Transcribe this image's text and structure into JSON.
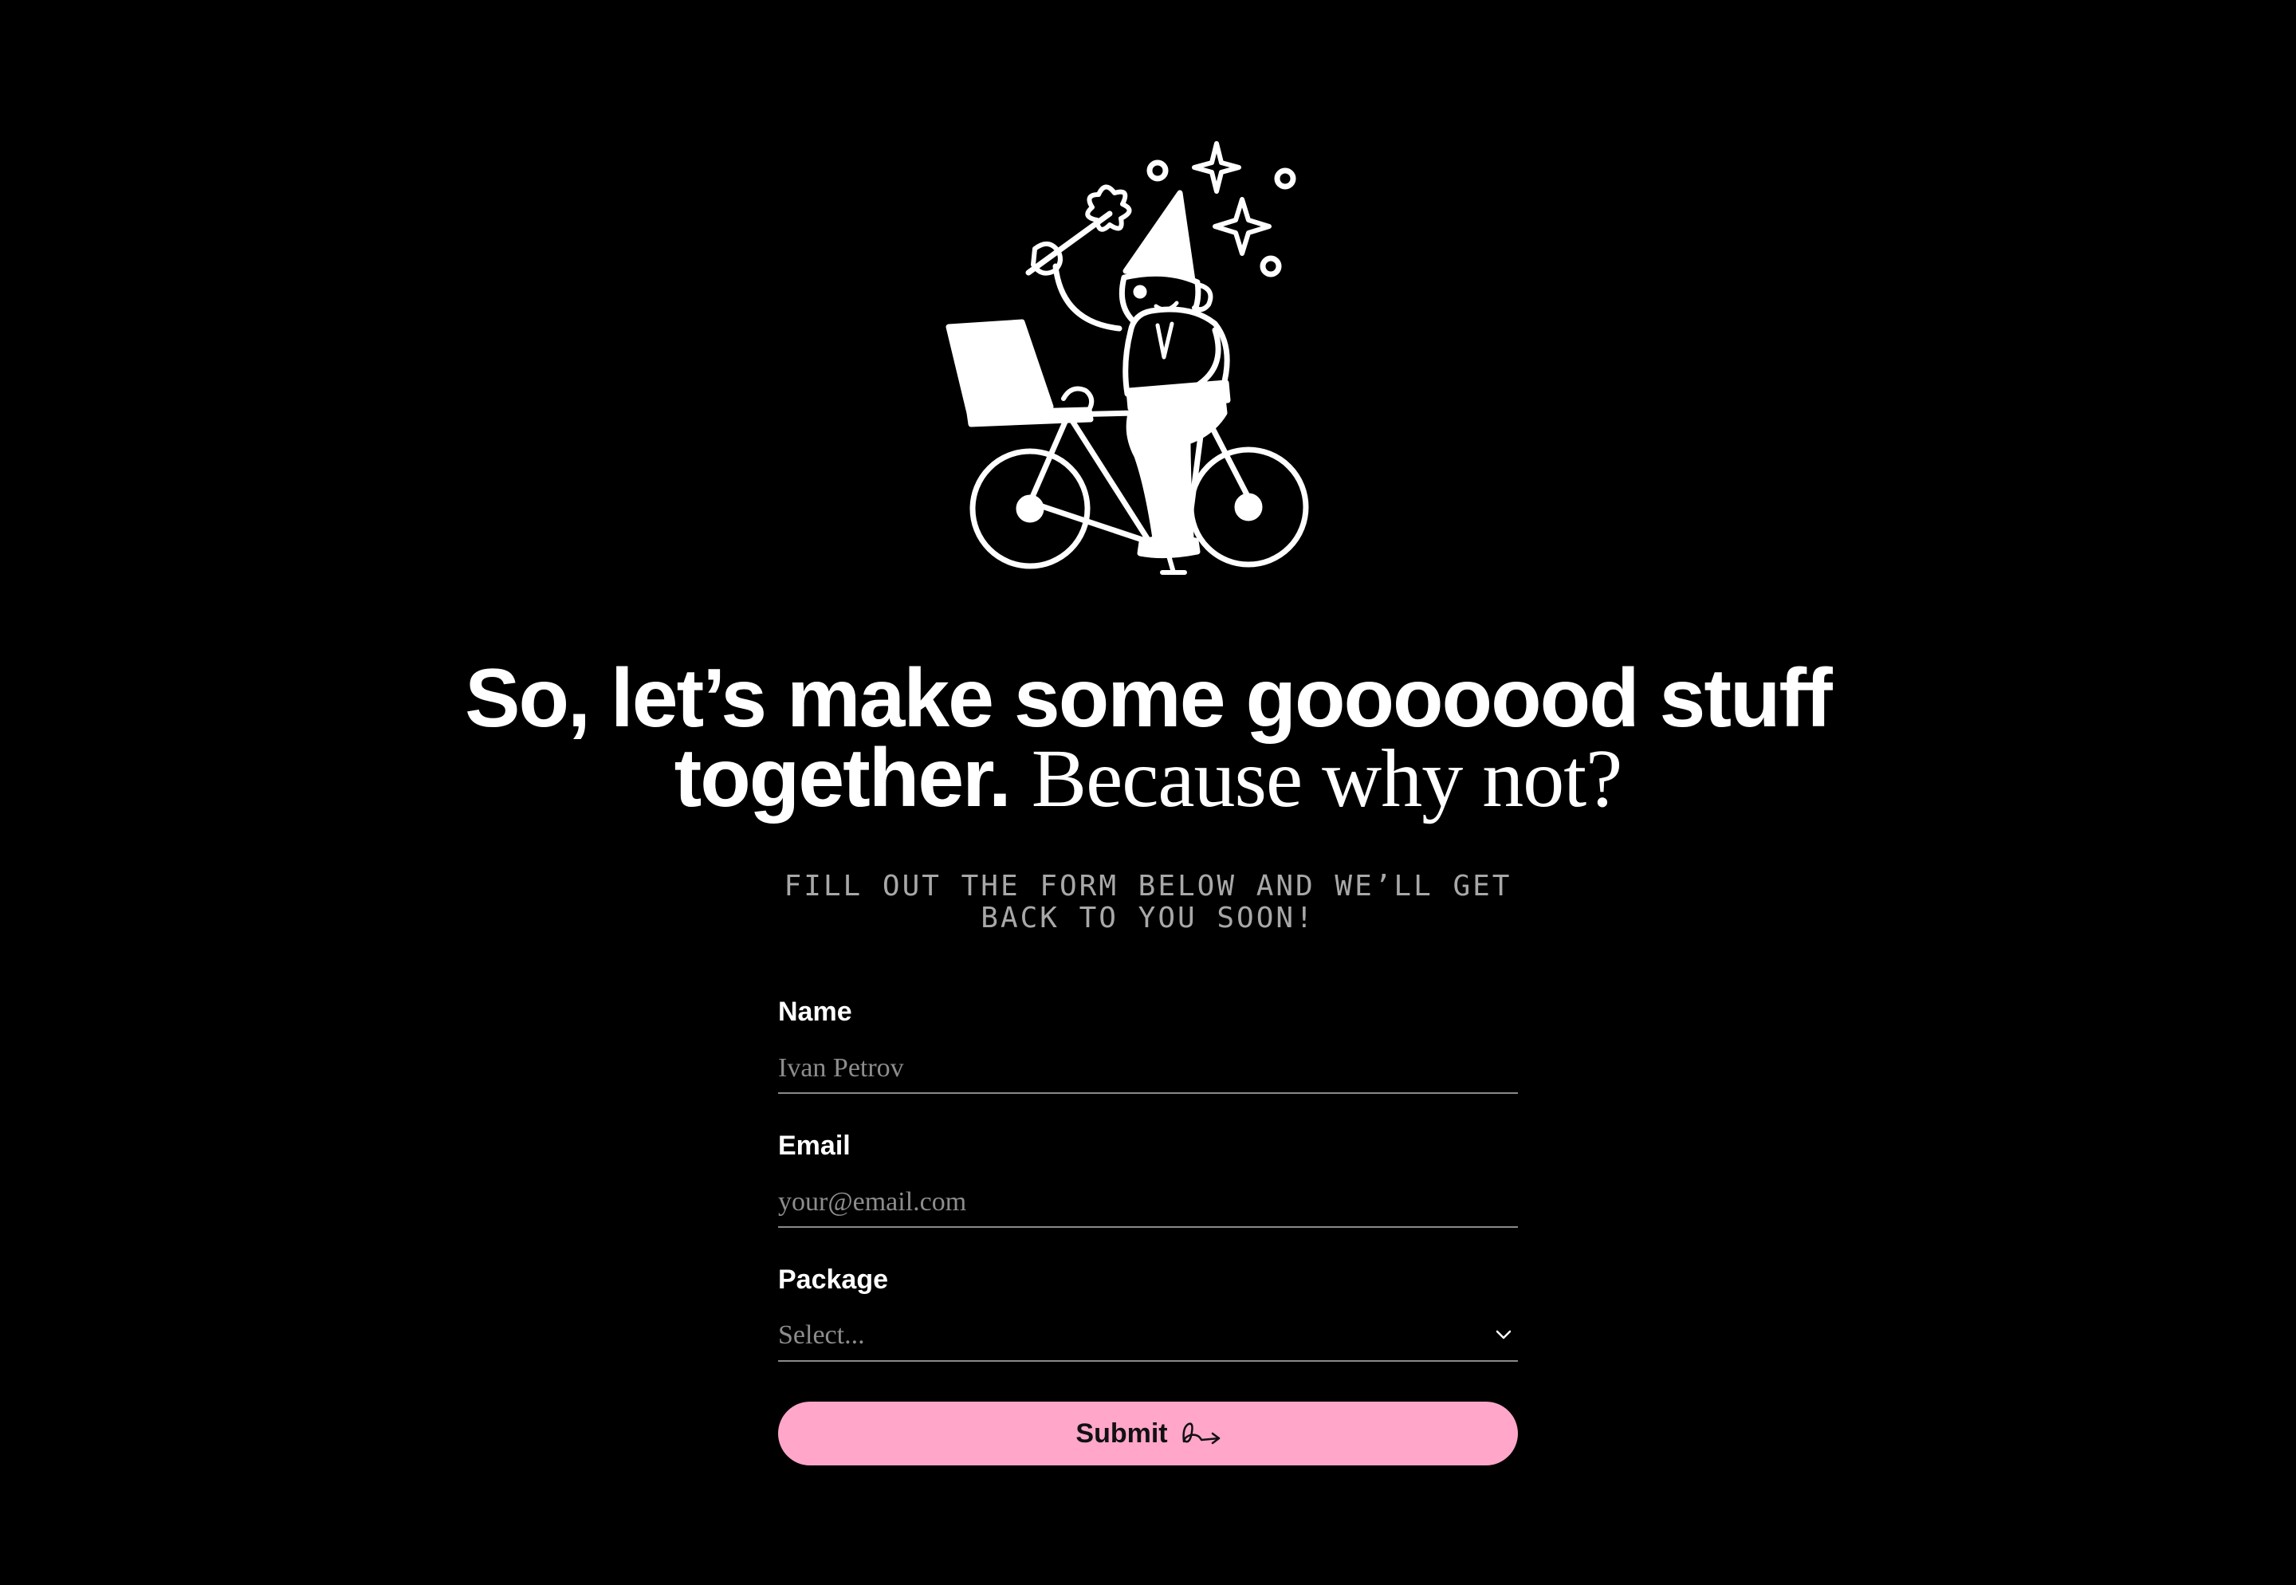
{
  "hero": {
    "headline_bold": "So, let’s make some gooooood stuff together.",
    "headline_light": "Because why not?",
    "subtext": "Fill out the form below and we’ll get back to you soon!"
  },
  "form": {
    "name": {
      "label": "Name",
      "placeholder": "Ivan Petrov"
    },
    "email": {
      "label": "Email",
      "placeholder": "your@email.com"
    },
    "package": {
      "label": "Package",
      "selected": "Select..."
    },
    "submit_label": "Submit"
  },
  "icons": {
    "illustration": "gnome-cyclist-with-laptop-illustration",
    "chevron": "chevron-down-icon",
    "submit": "squiggle-arrow-icon"
  },
  "colors": {
    "background": "#000000",
    "accent": "#ffa6c9",
    "text": "#ffffff",
    "muted": "#8d8d8d"
  }
}
